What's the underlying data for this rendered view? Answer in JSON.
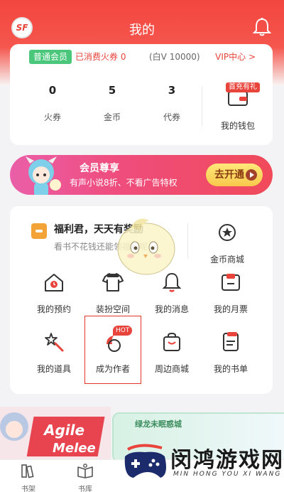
{
  "header": {
    "title": "我的",
    "logo_text": "SF",
    "bell_icon": "bell-icon"
  },
  "member": {
    "badge": "普通会员",
    "spent": "已消费火券 0",
    "bai_v": "(白V 10000)",
    "vip_link": "VIP中心 >",
    "stats": [
      {
        "value": "0",
        "label": "火券"
      },
      {
        "value": "5",
        "label": "金币"
      },
      {
        "value": "3",
        "label": "代券"
      }
    ],
    "wallet": {
      "tag": "首充有礼",
      "label": "我的钱包",
      "icon": "wallet-icon"
    }
  },
  "banner": {
    "title": "会员尊享",
    "subtitle": "有声小说8折、不看广告特权",
    "button": "去开通"
  },
  "welfare": {
    "title": "福利君，天天有奖励",
    "subtitle": "看书不花钱还能领福利呢",
    "icon": "gift-icon"
  },
  "grid": {
    "gold_mall": {
      "label": "金币商城",
      "icon": "star-badge-icon"
    },
    "items": [
      {
        "label": "我的预约",
        "icon": "house-clock-icon"
      },
      {
        "label": "装扮空间",
        "icon": "tshirt-icon"
      },
      {
        "label": "我的消息",
        "icon": "bell-icon"
      },
      {
        "label": "我的月票",
        "icon": "ticket-icon"
      },
      {
        "label": "我的道具",
        "icon": "magic-wand-icon"
      },
      {
        "label": "成为作者",
        "icon": "quill-icon",
        "badge": "HOT"
      },
      {
        "label": "周边商城",
        "icon": "shopping-bag-icon"
      },
      {
        "label": "我的书单",
        "icon": "booklist-icon"
      }
    ]
  },
  "promo": {
    "left_text": "Agile Melee",
    "right_text": "绿龙未眠惑城"
  },
  "tabbar": [
    {
      "label": "书架",
      "icon": "bookshelf-icon"
    },
    {
      "label": "书库",
      "icon": "library-icon"
    }
  ],
  "watermark": {
    "title": "闵鸿游戏网",
    "subtitle": "MIN HONG YOU XI WANG"
  },
  "colors": {
    "accent": "#e8443c",
    "member_green": "#4ac77b",
    "icon_red": "#e8443c"
  }
}
